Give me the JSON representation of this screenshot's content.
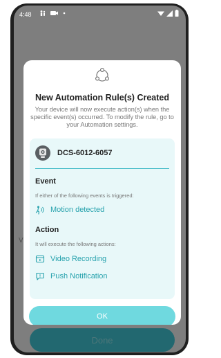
{
  "status_bar": {
    "time": "4:48"
  },
  "background": {
    "done_label": "Done",
    "partial_text": "V"
  },
  "dialog": {
    "title": "New Automation Rule(s) Created",
    "description": "Your device will now execute action(s) when the specific event(s) occurred. To modify the rule, go to your Automation settings.",
    "device": {
      "name": "DCS-6012-6057"
    },
    "event": {
      "title": "Event",
      "hint": "If either of the following events is triggered:",
      "items": [
        {
          "label": "Motion detected",
          "icon": "motion-icon"
        }
      ]
    },
    "action": {
      "title": "Action",
      "hint": "It will execute the following actions:",
      "items": [
        {
          "label": "Video Recording",
          "icon": "video-recording-icon"
        },
        {
          "label": "Push Notification",
          "icon": "push-notification-icon"
        }
      ]
    },
    "ok_label": "OK"
  },
  "colors": {
    "accent": "#27a2ad",
    "card_bg": "#e8f8f9",
    "ok_button": "#6fd9df",
    "done_button": "#226870"
  }
}
